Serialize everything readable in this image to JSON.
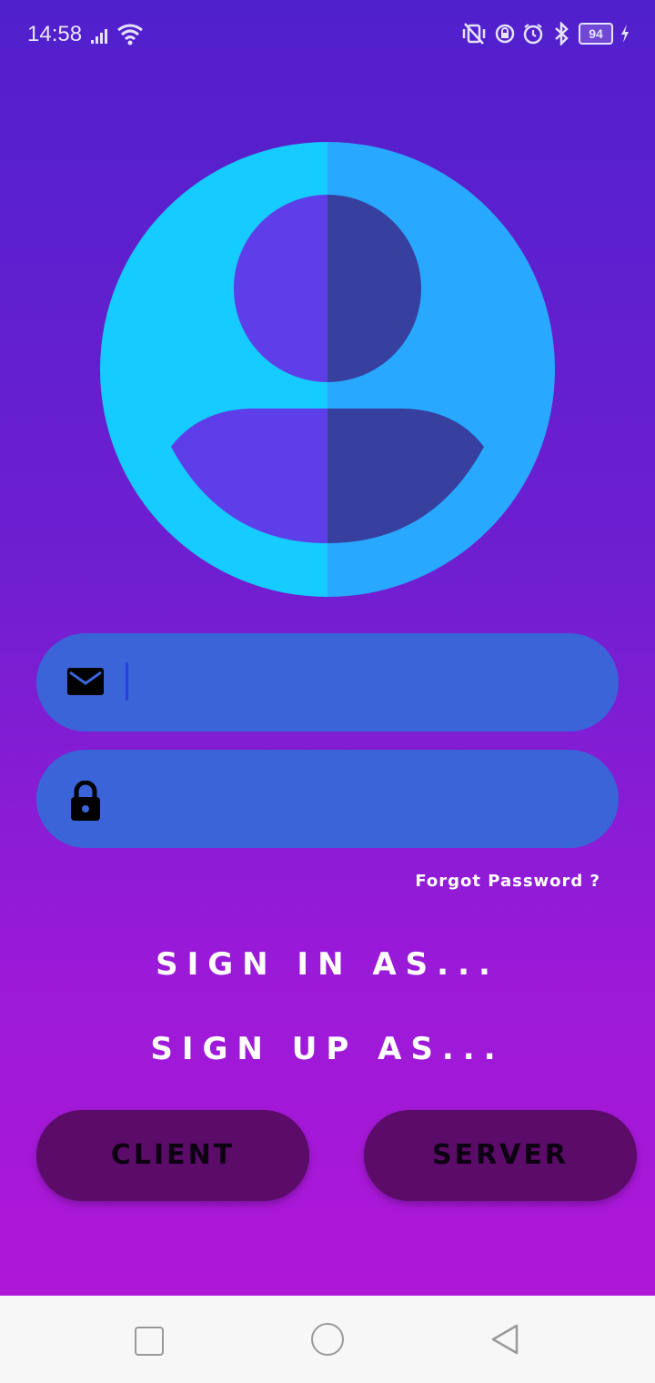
{
  "status_bar": {
    "time": "14:58",
    "battery": "94",
    "icons": [
      "signal-icon",
      "wifi-icon",
      "vibrate-icon",
      "rotation-lock-icon",
      "alarm-icon",
      "bluetooth-icon",
      "battery-icon",
      "charging-icon"
    ]
  },
  "avatar": {
    "icon": "user-avatar-icon",
    "colors": {
      "left": "#16cbff",
      "right": "#28a9ff",
      "figure_left": "#5e3ee8",
      "figure_right": "#37409e"
    }
  },
  "email_field": {
    "icon": "email-icon",
    "value": "",
    "placeholder": ""
  },
  "password_field": {
    "icon": "lock-icon",
    "value": "",
    "placeholder": ""
  },
  "forgot_password": "Forgot Password ?",
  "sign_in_label": "SIGN IN AS...",
  "sign_up_label": "SIGN UP AS...",
  "buttons": {
    "client": "CLIENT",
    "server": "SERVER"
  },
  "navigation": {
    "icons": [
      "recents-icon",
      "home-icon",
      "back-icon"
    ]
  },
  "colors": {
    "field_bg": "#3a64d8",
    "button_bg": "#5b0b68"
  }
}
